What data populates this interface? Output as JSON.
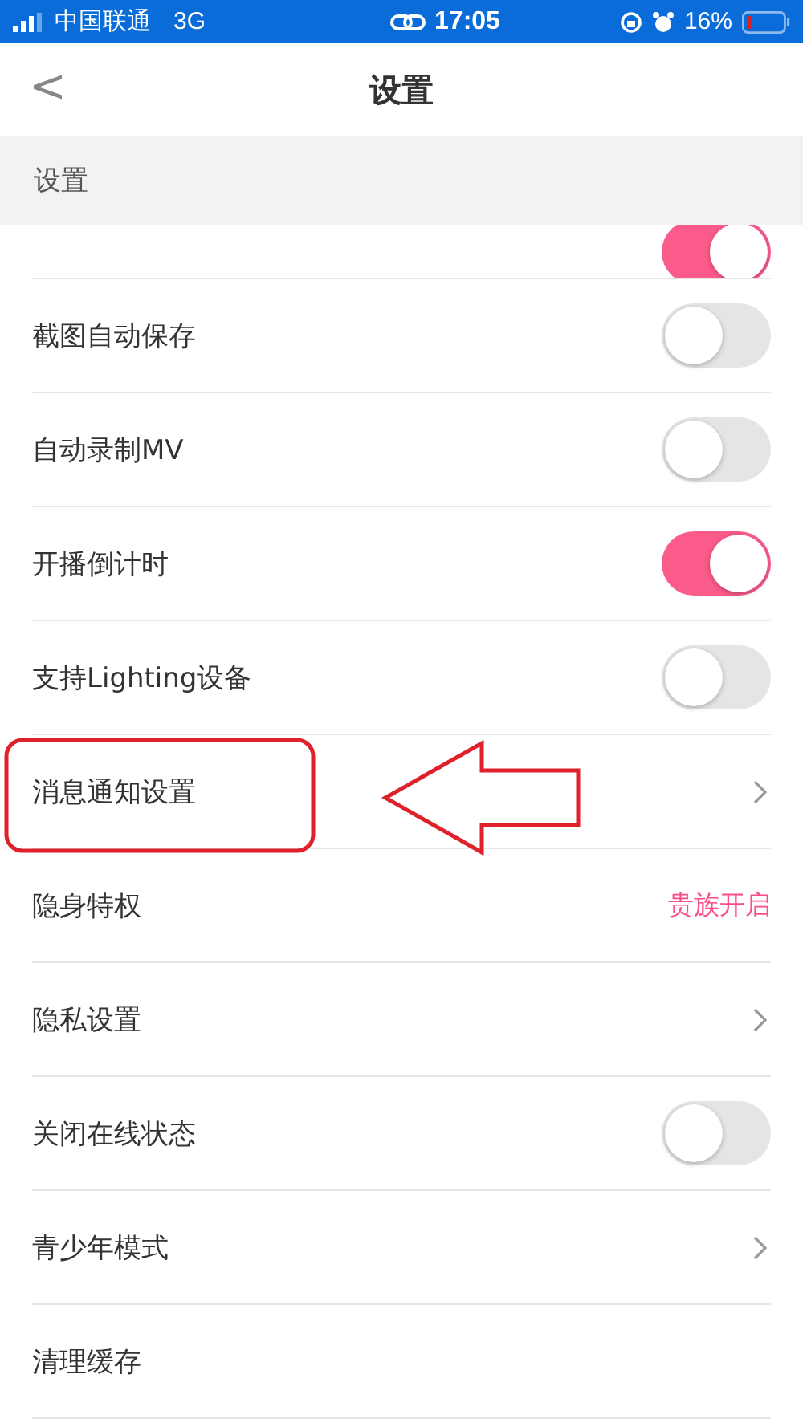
{
  "status_bar": {
    "carrier": "中国联通",
    "network": "3G",
    "time": "17:05",
    "battery": "16%"
  },
  "nav": {
    "back": "<",
    "title": "设置"
  },
  "section": {
    "title": "设置"
  },
  "rows": [
    {
      "kind": "toggle",
      "clipped": true,
      "on": true
    },
    {
      "kind": "toggle",
      "label": "截图自动保存",
      "on": false
    },
    {
      "kind": "toggle",
      "label": "自动录制MV",
      "on": false
    },
    {
      "kind": "toggle",
      "label": "开播倒计时",
      "on": true
    },
    {
      "kind": "toggle",
      "label": "支持Lighting设备",
      "on": false
    },
    {
      "kind": "link",
      "label": "消息通知设置"
    },
    {
      "kind": "value",
      "label": "隐身特权",
      "value": "贵族开启"
    },
    {
      "kind": "link",
      "label": "隐私设置"
    },
    {
      "kind": "toggle",
      "label": "关闭在线状态",
      "on": false
    },
    {
      "kind": "link",
      "label": "青少年模式"
    },
    {
      "kind": "plain",
      "label": "清理缓存"
    }
  ]
}
